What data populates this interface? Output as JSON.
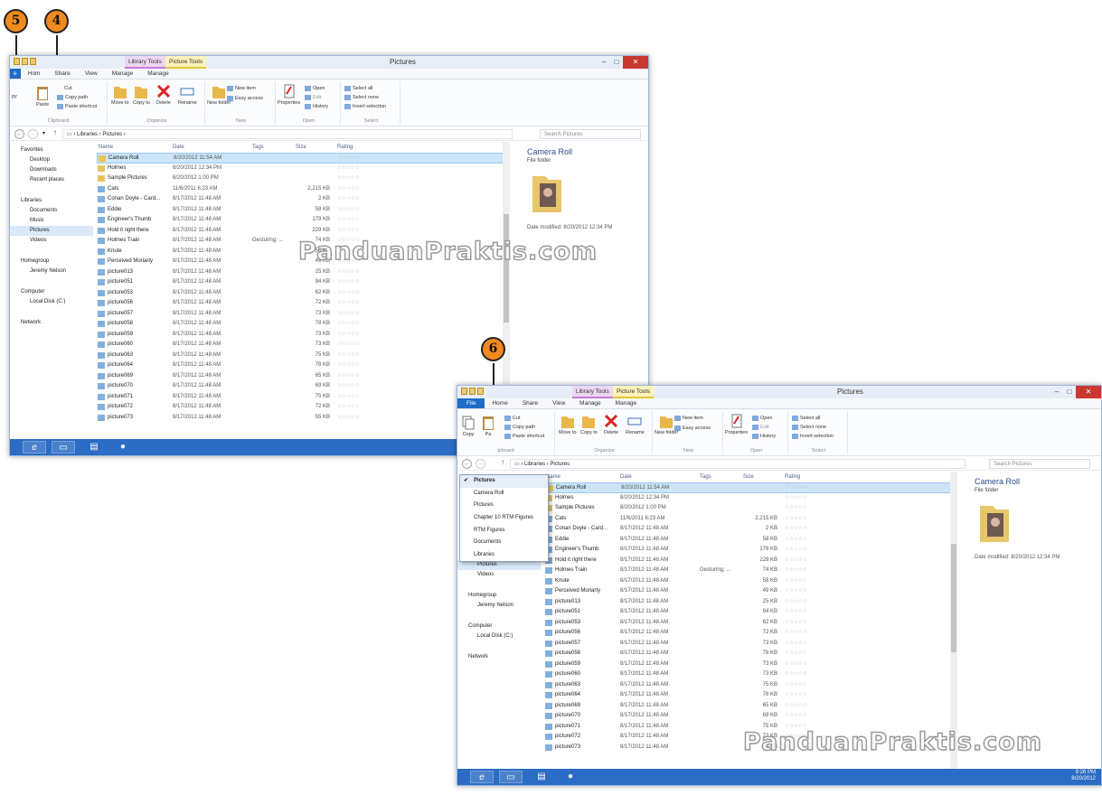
{
  "callouts": {
    "five": "5",
    "four": "4",
    "six": "6"
  },
  "window_title": "Pictures",
  "ctx_tabs": {
    "library_tools": "Library Tools",
    "picture_tools": "Picture Tools"
  },
  "tabs": {
    "file": "File",
    "home": "Home",
    "share": "Share",
    "view": "View",
    "manage1": "Manage",
    "manage2": "Manage"
  },
  "tabs_w1": {
    "home": "Hom",
    "share": "Share",
    "view": "View",
    "manage1": "Manage",
    "manage2": "Manage"
  },
  "ribbon": {
    "copy": "Copy",
    "paste": "Paste",
    "cut": "Cut",
    "copy_path": "Copy path",
    "paste_shortcut": "Paste shortcut",
    "move_to": "Move to",
    "copy_to": "Copy to",
    "delete": "Delete",
    "rename": "Rename",
    "new_folder": "New folder",
    "new_item": "New item",
    "easy_access": "Easy access",
    "properties": "Properties",
    "open": "Open",
    "edit": "Edit",
    "history": "History",
    "select_all": "Select all",
    "select_none": "Select none",
    "invert_selection": "Invert selection",
    "grp_clipboard": "Clipboard",
    "grp_organize": "Organize",
    "grp_new": "New",
    "grp_open": "Open",
    "grp_select": "Select"
  },
  "w1_ribbon_cut": {
    "copy": "py",
    "grp_clipboard": "Clipboard"
  },
  "w2_ribbon_cut": {
    "paste": "Pa",
    "grp_clipboard": "ipboard"
  },
  "address": {
    "seg1": "Libraries",
    "seg2": "Pictures",
    "search_placeholder": "Search Pictures"
  },
  "nav": {
    "favorites": "Favorites",
    "desktop": "Desktop",
    "downloads": "Downloads",
    "recent": "Recent places",
    "libraries": "Libraries",
    "documents": "Documents",
    "music": "Music",
    "pictures": "Pictures",
    "videos": "Videos",
    "homegroup": "Homegroup",
    "jeremy": "Jeremy Nelson",
    "computer": "Computer",
    "localdisk": "Local Disk (C:)",
    "network": "Network"
  },
  "columns": {
    "name": "Name",
    "date": "Date",
    "tags": "Tags",
    "size": "Size",
    "rating": "Rating"
  },
  "stars": "☆☆☆☆☆",
  "files": [
    {
      "name": "Camera Roll",
      "date": "8/20/2012 11:54 AM",
      "tags": "",
      "size": ""
    },
    {
      "name": "Holmes",
      "date": "8/20/2012 12:34 PM",
      "tags": "",
      "size": ""
    },
    {
      "name": "Sample Pictures",
      "date": "8/20/2012 1:00 PM",
      "tags": "",
      "size": ""
    },
    {
      "name": "Cats",
      "date": "11/6/2011 6:23 AM",
      "tags": "",
      "size": "2,215 KB"
    },
    {
      "name": "Conan Doyle - Card...",
      "date": "8/17/2012 11:48 AM",
      "tags": "",
      "size": "2 KB"
    },
    {
      "name": "Eddie",
      "date": "8/17/2012 11:48 AM",
      "tags": "",
      "size": "58 KB"
    },
    {
      "name": "Engineer's Thumb",
      "date": "8/17/2012 11:48 AM",
      "tags": "",
      "size": "179 KB"
    },
    {
      "name": "Hold it right there",
      "date": "8/17/2012 11:48 AM",
      "tags": "",
      "size": "229 KB"
    },
    {
      "name": "Holmes Train",
      "date": "8/17/2012 11:48 AM",
      "tags": "Gesturing; ...",
      "size": "74 KB"
    },
    {
      "name": "Knute",
      "date": "8/17/2012 11:48 AM",
      "tags": "",
      "size": "58 KB"
    },
    {
      "name": "Perceived Moriarty",
      "date": "8/17/2012 11:48 AM",
      "tags": "",
      "size": "49 KB"
    },
    {
      "name": "picture013",
      "date": "8/17/2012 11:48 AM",
      "tags": "",
      "size": "25 KB"
    },
    {
      "name": "picture051",
      "date": "8/17/2012 11:48 AM",
      "tags": "",
      "size": "94 KB"
    },
    {
      "name": "picture053",
      "date": "8/17/2012 11:48 AM",
      "tags": "",
      "size": "62 KB"
    },
    {
      "name": "picture056",
      "date": "8/17/2012 11:48 AM",
      "tags": "",
      "size": "72 KB"
    },
    {
      "name": "picture057",
      "date": "8/17/2012 11:48 AM",
      "tags": "",
      "size": "73 KB"
    },
    {
      "name": "picture058",
      "date": "8/17/2012 11:48 AM",
      "tags": "",
      "size": "78 KB"
    },
    {
      "name": "picture059",
      "date": "8/17/2012 11:48 AM",
      "tags": "",
      "size": "73 KB"
    },
    {
      "name": "picture060",
      "date": "8/17/2012 11:48 AM",
      "tags": "",
      "size": "73 KB"
    },
    {
      "name": "picture063",
      "date": "8/17/2012 11:48 AM",
      "tags": "",
      "size": "75 KB"
    },
    {
      "name": "picture064",
      "date": "8/17/2012 11:48 AM",
      "tags": "",
      "size": "78 KB"
    },
    {
      "name": "picture069",
      "date": "8/17/2012 11:48 AM",
      "tags": "",
      "size": "65 KB"
    },
    {
      "name": "picture070",
      "date": "8/17/2012 11:48 AM",
      "tags": "",
      "size": "69 KB"
    },
    {
      "name": "picture071",
      "date": "8/17/2012 11:48 AM",
      "tags": "",
      "size": "75 KB"
    },
    {
      "name": "picture072",
      "date": "8/17/2012 11:48 AM",
      "tags": "",
      "size": "72 KB"
    },
    {
      "name": "picture073",
      "date": "8/17/2012 11:48 AM",
      "tags": "",
      "size": "55 KB"
    }
  ],
  "preview": {
    "title": "Camera Roll",
    "subtitle": "File folder",
    "date_label": "Date modified:",
    "date_value": "8/20/2012 12:34 PM"
  },
  "dropdown": [
    "Pictures",
    "Camera Roll",
    "Pictures",
    "Chapter 10 RTM Figures",
    "RTM Figures",
    "Documents",
    "Libraries"
  ],
  "tray": {
    "time": "9:26 PM",
    "date": "8/20/2012"
  },
  "watermark": "PanduanPraktis.com"
}
